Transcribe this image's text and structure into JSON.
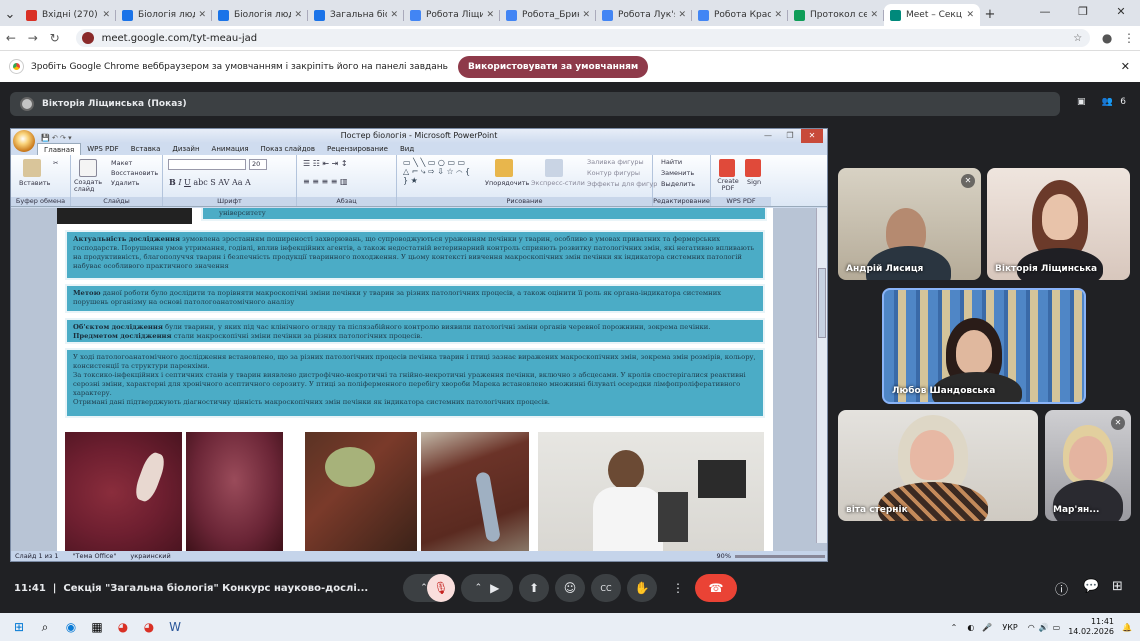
{
  "browser": {
    "tabs": [
      {
        "title": "Вхідні (270) - ",
        "icon_color": "#d93025",
        "active": false
      },
      {
        "title": "Біологія людин",
        "icon_color": "#1a73e8",
        "active": false
      },
      {
        "title": "Біологія людин",
        "icon_color": "#1a73e8",
        "active": false
      },
      {
        "title": "Загальна біолог",
        "icon_color": "#1a73e8",
        "active": false
      },
      {
        "title": "Робота Ліщинсь",
        "icon_color": "#4285f4",
        "active": false
      },
      {
        "title": "Робота_Брикова",
        "icon_color": "#4285f4",
        "active": false
      },
      {
        "title": "Робота Лук'ячну",
        "icon_color": "#4285f4",
        "active": false
      },
      {
        "title": "Робота Красіна А",
        "icon_color": "#4285f4",
        "active": false
      },
      {
        "title": "Протокол секції",
        "icon_color": "#0f9d58",
        "active": false
      },
      {
        "title": "Meet – Секц",
        "icon_color": "#00897b",
        "active": true
      }
    ],
    "url": "meet.google.com/tyt-meau-jad",
    "banner_text": "Зробіть Google Chrome веббраузером за умовчанням і закріпіть його на панелі завдань",
    "banner_button": "Використовувати за умовчанням"
  },
  "meet": {
    "presenter_label": "Вікторія Ліщинська (Показ)",
    "participant_count": "6",
    "participants": [
      {
        "name": "Андрій Лисиця"
      },
      {
        "name": "Вікторія Ліщинська"
      },
      {
        "name": "Любов Шандовська"
      },
      {
        "name": "віта стернік"
      },
      {
        "name": "Мар'ян..."
      }
    ],
    "time": "11:41",
    "meeting_title": "Секція \"Загальна біологія\" Конкурс науково-дослі..."
  },
  "powerpoint": {
    "title": "Постер біологія - Microsoft PowerPoint",
    "tabs": [
      "Главная",
      "WPS PDF",
      "Вставка",
      "Дизайн",
      "Анимация",
      "Показ слайдов",
      "Рецензирование",
      "Вид"
    ],
    "groups": {
      "buffer": "Буфер обмена",
      "slides": "Слайды",
      "font": "Шрифт",
      "paragraph": "Абзац",
      "drawing": "Рисование",
      "editing": "Редактирование",
      "wps": "WPS PDF"
    },
    "buttons": {
      "paste": "Вставить",
      "new_slide": "Создать слайд",
      "layout": "Макет",
      "reset": "Восстановить",
      "delete": "Удалить",
      "arrange": "Упорядочить",
      "quick_styles": "Экспресс-стили",
      "fill": "Заливка фигуры",
      "outline": "Контур фигуры",
      "effects": "Эффекты для фигур",
      "find": "Найти",
      "replace": "Заменить",
      "select": "Выделить",
      "create_pdf": "Create PDF",
      "sign": "Sign",
      "font_size": "20"
    },
    "status": {
      "slide": "Слайд 1 из 1",
      "theme": "\"Тема Office\"",
      "language": "украинский",
      "zoom": "90%"
    }
  },
  "slide": {
    "top_fragment": "університету",
    "relevance_label": "Актуальність дослідження",
    "relevance_text": " зумовлена зростанням поширеності захворювань, що супроводжуються ураженням печінки у тварин, особливо в умовах приватних та фермерських господарств. Порушення умов утримання, годівлі, вплив інфекційних агентів, а також недостатній ветеринарний контроль сприяють розвитку патологічних змін, які негативно впливають на продуктивність, благополуччя тварин і безпечність продукції тваринного походження. У цьому контексті вивчення макроскопічних змін печінки як індикатора системних патологій набуває особливого практичного значення",
    "method_label": "Метою",
    "method_text": " даної роботи було дослідити та порівняти макроскопічні зміни печінки у тварин за різних патологічних процесів, а також оцінити її роль як органа-індикатора системних порушень організму на основі патологоанатомічного аналізу",
    "object_label": "Об'єктом дослідження",
    "object_text": " були тварини, у яких під час клінічного огляду та післязабійного контролю виявили патологічні зміни органів черевної порожнини, зокрема печінки. ",
    "subject_label": "Предметом дослідження",
    "subject_text": " стали макроскопічні зміни печінки за різних патологічних процесів.",
    "results_lines": [
      "У ході патологоанатомічного дослідження встановлено, що за різних патологічних процесів печінка тварин і птиці зазнає виражених макроскопічних змін, зокрема змін розмірів, кольору, консистенції та структури паренхіми.",
      "За токсико-інфекційних і септичних станів у тварин виявлено дистрофічно-некротичні та гнійно-некротичні ураження печінки, включно з абсцесами. У кролів спостерігалися реактивні серозні зміни, характерні для хронічного асептичного серозиту. У птиці за поліферменного перебігу хвороби Марека встановлено множинні білуваті осередки лімфопроліферативного характеру.",
      "Отримані дані підтверджують діагностичну цінність макроскопічних змін печінки як індикатора системних патологічних процесів."
    ]
  },
  "taskbar": {
    "lang": "УКР",
    "time": "11:41",
    "date": "14.02.2026"
  }
}
